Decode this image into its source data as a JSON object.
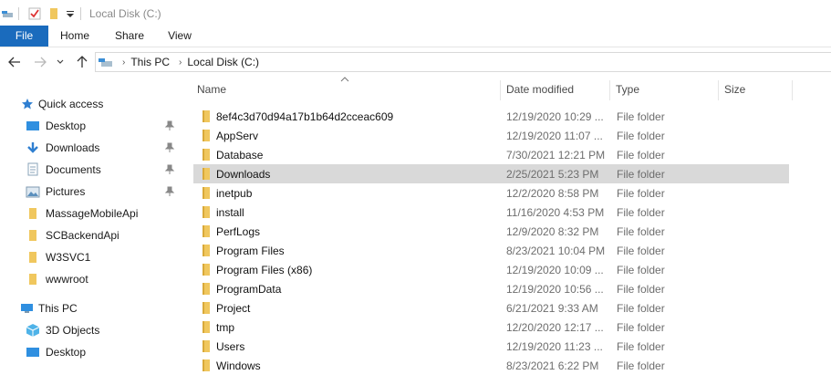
{
  "window": {
    "title": "Local Disk (C:)"
  },
  "ribbon": {
    "tabs": [
      {
        "label": "File"
      },
      {
        "label": "Home"
      },
      {
        "label": "Share"
      },
      {
        "label": "View"
      }
    ]
  },
  "address": {
    "crumbs": [
      {
        "label": "This PC"
      },
      {
        "label": "Local Disk (C:)"
      }
    ]
  },
  "sidebar": {
    "quick_access": "Quick access",
    "quick_items": [
      {
        "label": "Desktop",
        "icon": "desktop-icon",
        "pinned": true
      },
      {
        "label": "Downloads",
        "icon": "downloads-icon",
        "pinned": true
      },
      {
        "label": "Documents",
        "icon": "documents-icon",
        "pinned": true
      },
      {
        "label": "Pictures",
        "icon": "pictures-icon",
        "pinned": true
      },
      {
        "label": "MassageMobileApi",
        "icon": "folder-icon",
        "pinned": false
      },
      {
        "label": "SCBackendApi",
        "icon": "folder-icon",
        "pinned": false
      },
      {
        "label": "W3SVC1",
        "icon": "folder-icon",
        "pinned": false
      },
      {
        "label": "wwwroot",
        "icon": "folder-icon",
        "pinned": false
      }
    ],
    "this_pc": "This PC",
    "pc_items": [
      {
        "label": "3D Objects",
        "icon": "3d-objects-icon"
      },
      {
        "label": "Desktop",
        "icon": "desktop-icon"
      }
    ]
  },
  "columns": {
    "name": "Name",
    "date": "Date modified",
    "type": "Type",
    "size": "Size"
  },
  "files": [
    {
      "name": "8ef4c3d70d94a17b1b64d2cceac609",
      "date": "12/19/2020 10:29 ...",
      "type": "File folder"
    },
    {
      "name": "AppServ",
      "date": "12/19/2020 11:07 ...",
      "type": "File folder"
    },
    {
      "name": "Database",
      "date": "7/30/2021 12:21 PM",
      "type": "File folder"
    },
    {
      "name": "Downloads",
      "date": "2/25/2021 5:23 PM",
      "type": "File folder",
      "selected": true
    },
    {
      "name": "inetpub",
      "date": "12/2/2020 8:58 PM",
      "type": "File folder"
    },
    {
      "name": "install",
      "date": "11/16/2020 4:53 PM",
      "type": "File folder"
    },
    {
      "name": "PerfLogs",
      "date": "12/9/2020 8:32 PM",
      "type": "File folder"
    },
    {
      "name": "Program Files",
      "date": "8/23/2021 10:04 PM",
      "type": "File folder"
    },
    {
      "name": "Program Files (x86)",
      "date": "12/19/2020 10:09 ...",
      "type": "File folder"
    },
    {
      "name": "ProgramData",
      "date": "12/19/2020 10:56 ...",
      "type": "File folder"
    },
    {
      "name": "Project",
      "date": "6/21/2021 9:33 AM",
      "type": "File folder"
    },
    {
      "name": "tmp",
      "date": "12/20/2020 12:17 ...",
      "type": "File folder"
    },
    {
      "name": "Users",
      "date": "12/19/2020 11:23 ...",
      "type": "File folder"
    },
    {
      "name": "Windows",
      "date": "8/23/2021 6:22 PM",
      "type": "File folder"
    }
  ],
  "colors": {
    "accent": "#1a6bbd",
    "folder": "#e8b84a",
    "selection": "#d9d9d9"
  }
}
